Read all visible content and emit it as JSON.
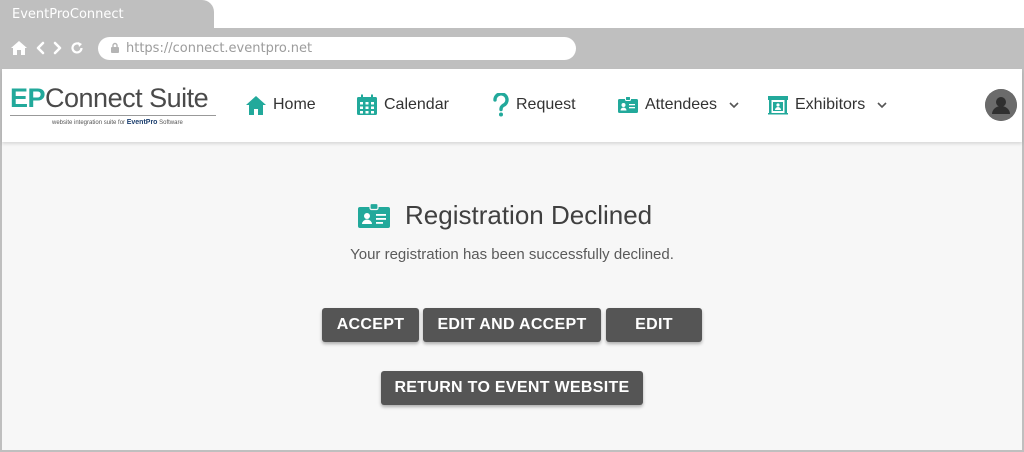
{
  "browser": {
    "tab_title": "EventProConnect",
    "url": "https://connect.eventpro.net"
  },
  "logo": {
    "ep": "EP",
    "name": "Connect Suite",
    "tagline_prefix": "website integration suite for",
    "tagline_brand": "EventPro",
    "tagline_suffix": "Software"
  },
  "nav": {
    "items": [
      {
        "label": "Home",
        "icon": "home-icon",
        "dropdown": false
      },
      {
        "label": "Calendar",
        "icon": "calendar-icon",
        "dropdown": false
      },
      {
        "label": "Request",
        "icon": "question-icon",
        "dropdown": false
      },
      {
        "label": "Attendees",
        "icon": "id-badge-icon",
        "dropdown": true
      },
      {
        "label": "Exhibitors",
        "icon": "booth-icon",
        "dropdown": true
      }
    ]
  },
  "content": {
    "heading": "Registration Declined",
    "message": "Your registration has been successfully declined.",
    "buttons": {
      "accept": "ACCEPT",
      "edit_and_accept": "EDIT AND ACCEPT",
      "edit": "EDIT",
      "return": "RETURN TO EVENT WEBSITE"
    }
  },
  "colors": {
    "accent_teal": "#22a99b",
    "button_bg": "#555555",
    "chrome_gray": "#bfbfbf",
    "content_bg": "#f7f7f7"
  }
}
